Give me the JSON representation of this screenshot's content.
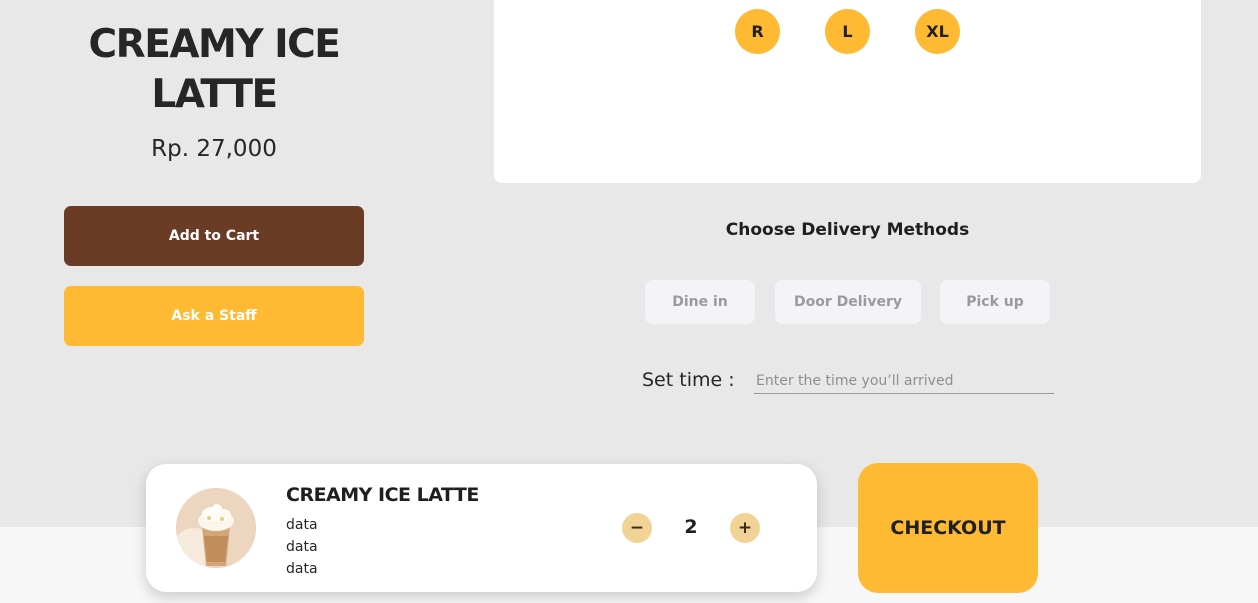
{
  "product": {
    "title": "CREAMY ICE LATTE",
    "price": "Rp. 27,000",
    "add_to_cart_label": "Add to Cart",
    "ask_staff_label": "Ask a Staff"
  },
  "sizes": [
    "R",
    "L",
    "XL"
  ],
  "delivery": {
    "heading": "Choose Delivery Methods",
    "options": [
      "Dine in",
      "Door Delivery",
      "Pick up"
    ],
    "set_time_label": "Set time :",
    "time_placeholder": "Enter the time you’ll arrived"
  },
  "cart": {
    "title": "CREAMY ICE LATTE",
    "details": [
      "data",
      "data",
      "data"
    ],
    "quantity": "2",
    "minus_label": "−",
    "plus_label": "+",
    "thumbnail_icon": "iced-latte-image"
  },
  "checkout_label": "CHECKOUT",
  "colors": {
    "brown": "#6a3c25",
    "accent_yellow": "#ffba33",
    "qty_button": "#f2d396",
    "page_bg": "#e8e8e8"
  }
}
